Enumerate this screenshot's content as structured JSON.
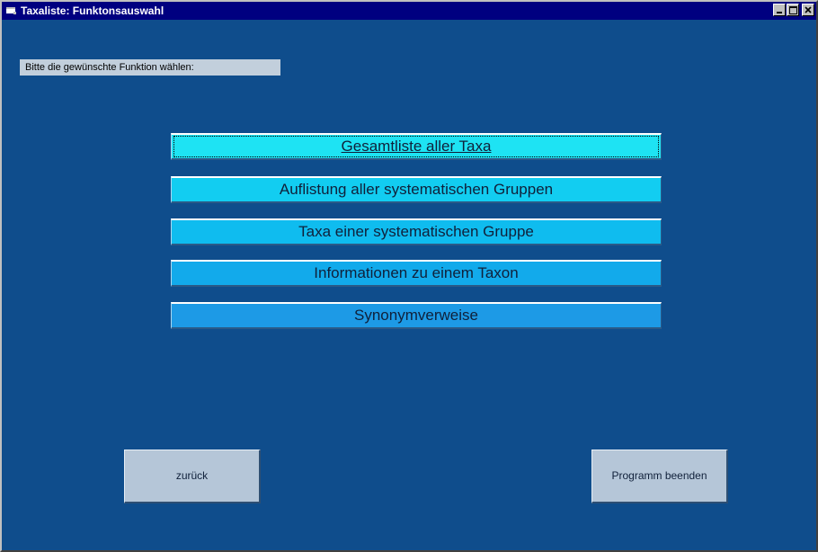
{
  "window": {
    "title": "Taxaliste: Funktonsauswahl",
    "controls": {
      "minimize_icon": "minimize-icon",
      "maximize_icon": "maximize-icon",
      "close_icon": "close-icon"
    }
  },
  "prompt": {
    "text": "Bitte die gewünschte Funktion wählen:"
  },
  "functions": [
    {
      "label": "Gesamtliste aller Taxa"
    },
    {
      "label": "Auflistung aller systematischen Gruppen"
    },
    {
      "label": "Taxa einer systematischen Gruppe"
    },
    {
      "label": "Informationen zu einem Taxon"
    },
    {
      "label": "Synonymverweise"
    }
  ],
  "footer": {
    "back_label": "zurück",
    "quit_label": "Programm beenden"
  },
  "colors": {
    "background": "#0f4d8c",
    "titlebar": "#000080",
    "button_cyan": "#1ee3f3",
    "button_blue": "#1d9ae6",
    "grey_button": "#b5c6d8"
  }
}
